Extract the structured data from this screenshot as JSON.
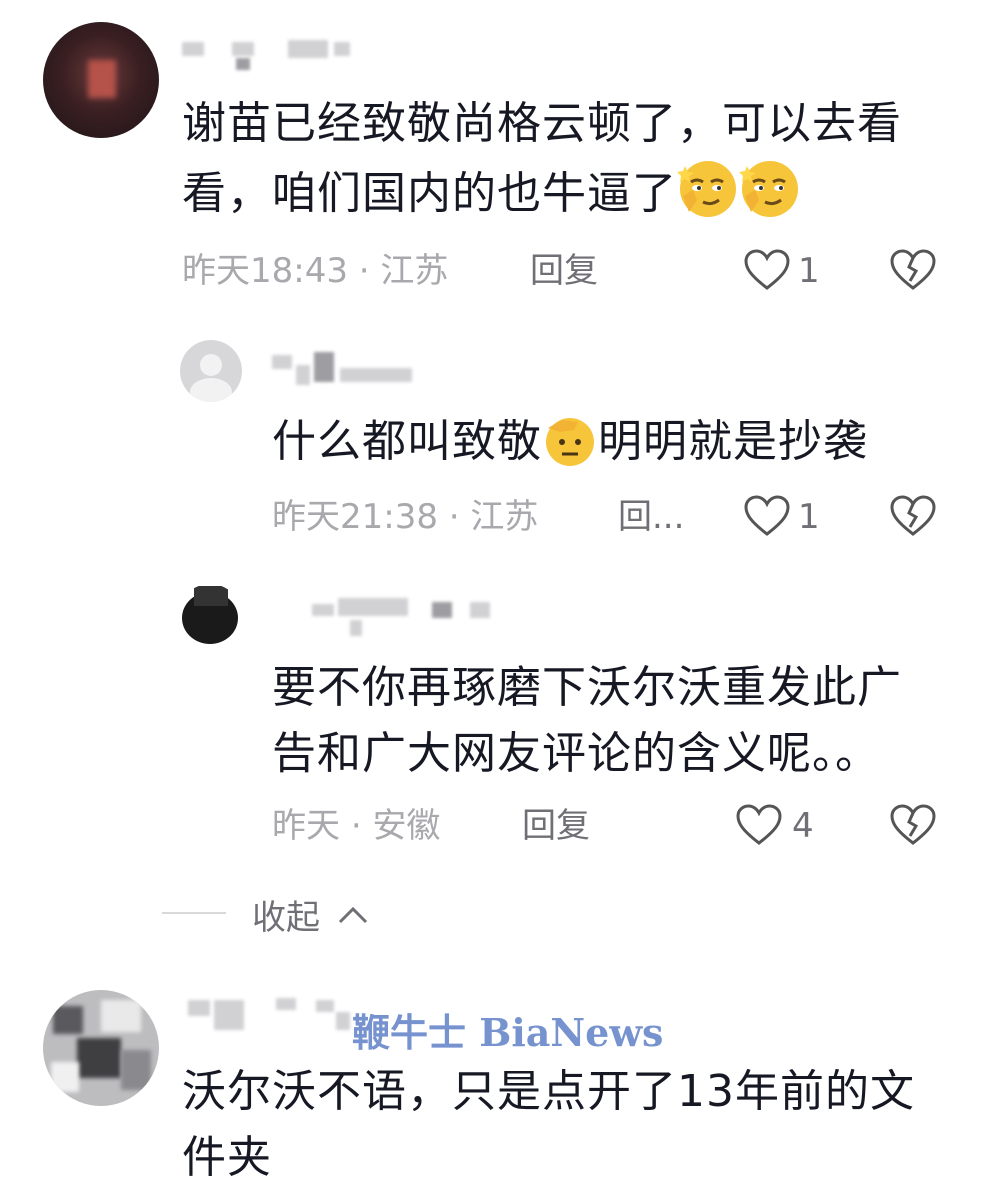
{
  "comments": [
    {
      "text_line1": "谢苗已经致敬尚格云顿了，可以去看",
      "text_line2": "看，咱们国内的也牛逼了",
      "time": "昨天18:43",
      "location": "江苏",
      "reply_label": "回复",
      "likes": "1"
    },
    {
      "text_before_emoji": "什么都叫致敬",
      "text_after_emoji": "明明就是抄袭",
      "time": "昨天21:38",
      "location": "江苏",
      "reply_label": "回...",
      "likes": "1"
    },
    {
      "text_line1": "要不你再琢磨下沃尔沃重发此广",
      "text_line2": "告和广大网友评论的含义呢。。",
      "time": "昨天",
      "location": "安徽",
      "reply_label": "回复",
      "likes": "4"
    },
    {
      "text_line1": "沃尔沃不语，只是点开了13年前的文",
      "text_line2": "件夹"
    }
  ],
  "separator": "·",
  "collapse_label": "收起",
  "watermark": "鞭牛士 BiaNews",
  "icons": {
    "like": "heart-outline-icon",
    "dislike": "broken-heart-icon",
    "collapse": "chevron-up-icon",
    "emoji_1": "smirk-emoji-icon",
    "emoji_2": "salute-emoji-icon"
  }
}
